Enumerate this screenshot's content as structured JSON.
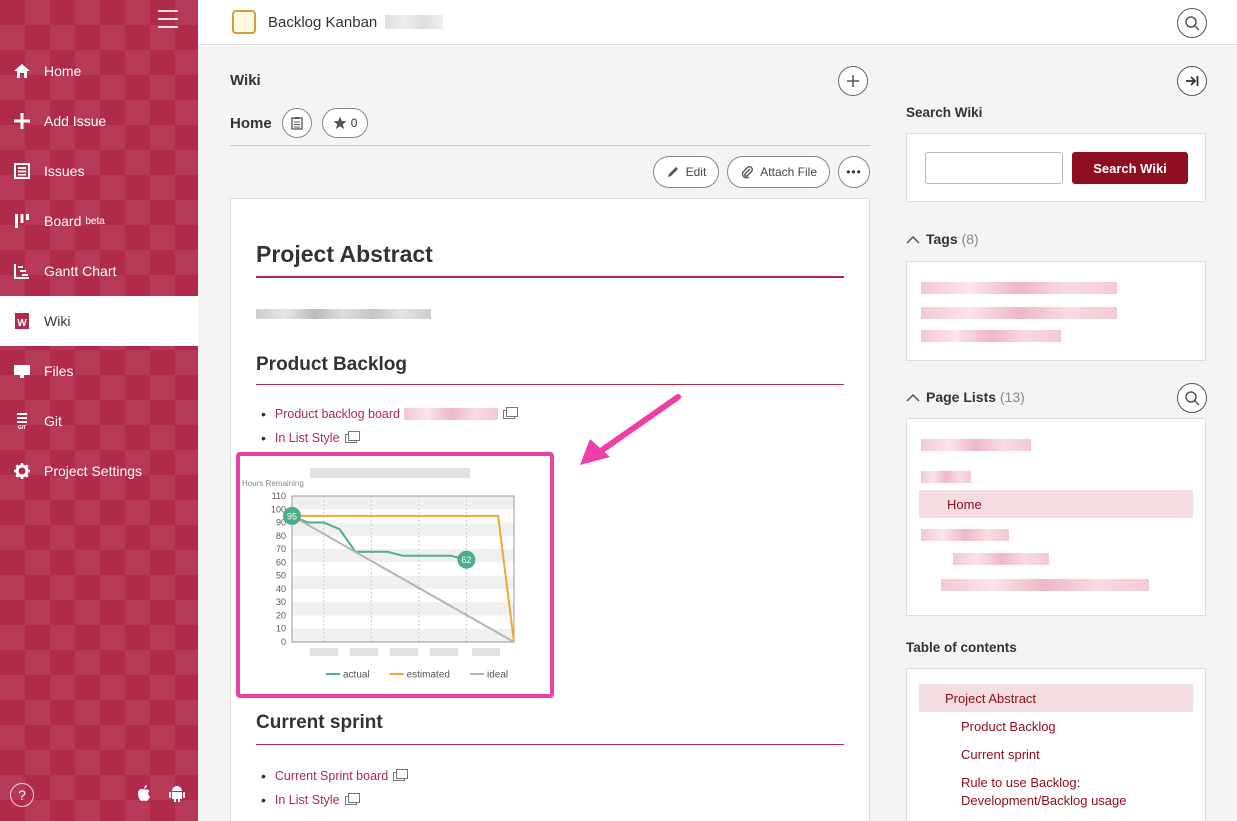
{
  "header": {
    "project_title": "Backlog Kanban"
  },
  "sidebar": {
    "items": [
      {
        "label": "Home",
        "icon": "home-icon"
      },
      {
        "label": "Add Issue",
        "icon": "plus-icon"
      },
      {
        "label": "Issues",
        "icon": "list-icon"
      },
      {
        "label": "Board",
        "sup": "beta",
        "icon": "board-icon"
      },
      {
        "label": "Gantt Chart",
        "icon": "gantt-icon"
      },
      {
        "label": "Wiki",
        "icon": "wiki-icon"
      },
      {
        "label": "Files",
        "icon": "files-icon"
      },
      {
        "label": "Git",
        "icon": "git-icon"
      },
      {
        "label": "Project Settings",
        "icon": "gear-icon"
      }
    ],
    "help": "?"
  },
  "main": {
    "section_title": "Wiki",
    "page_title": "Home",
    "star_count": "0",
    "edit_label": "Edit",
    "attach_label": "Attach File",
    "more_label": "•••",
    "content": {
      "h_abstract": "Project Abstract",
      "h_backlog": "Product Backlog",
      "backlog_links": [
        "Product backlog board",
        "In List Style"
      ],
      "h_sprint": "Current sprint",
      "sprint_links": [
        "Current Sprint board",
        "In List Style"
      ]
    }
  },
  "chart_data": {
    "type": "line",
    "ylabel": "Hours Remaining",
    "ylim": [
      0,
      110
    ],
    "yticks": [
      0,
      10,
      20,
      30,
      40,
      50,
      60,
      70,
      80,
      90,
      100,
      110
    ],
    "series": [
      {
        "name": "actual",
        "color": "#4caf8a",
        "x": [
          0,
          1,
          2,
          3,
          4,
          5,
          6,
          7,
          8,
          9,
          10,
          11
        ],
        "values": [
          95,
          90,
          90,
          85,
          68,
          68,
          68,
          65,
          65,
          65,
          65,
          62
        ]
      },
      {
        "name": "estimated",
        "color": "#f0a630",
        "x": [
          0,
          1,
          2,
          3,
          4,
          5,
          6,
          7,
          8,
          9,
          10,
          11,
          12,
          13,
          14
        ],
        "values": [
          95,
          95,
          95,
          95,
          95,
          95,
          95,
          95,
          95,
          95,
          95,
          95,
          95,
          95,
          0
        ]
      },
      {
        "name": "ideal",
        "color": "#b5b5b5",
        "x": [
          0,
          14
        ],
        "values": [
          95,
          0
        ]
      }
    ],
    "labels": {
      "start": "95",
      "end": "62"
    },
    "legend_position": "bottom"
  },
  "right": {
    "search_title": "Search Wiki",
    "search_button": "Search Wiki",
    "tags_title": "Tags",
    "tags_count": "(8)",
    "pages_title": "Page Lists",
    "pages_count": "(13)",
    "page_selected": "Home",
    "toc_title": "Table of contents",
    "toc": [
      "Project Abstract",
      "Product Backlog",
      "Current sprint",
      "Rule to use Backlog:",
      "Development/Backlog usage"
    ]
  }
}
